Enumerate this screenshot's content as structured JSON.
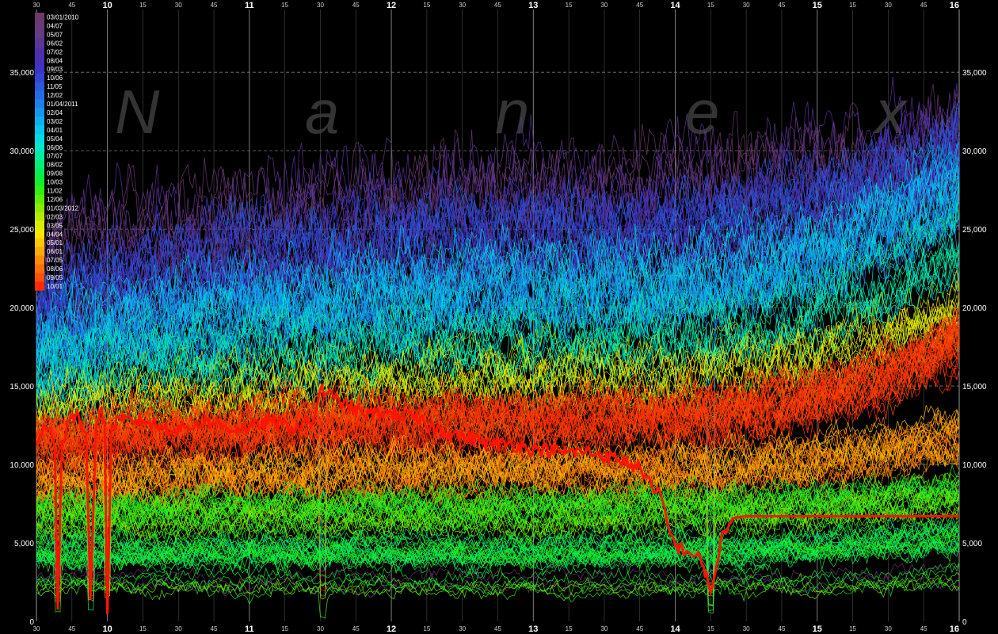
{
  "chart_data": {
    "type": "line",
    "title": "",
    "watermark": [
      "N",
      "a",
      "n",
      "e",
      "x"
    ],
    "xlabel": "",
    "ylabel": "",
    "ylim": [
      0,
      39000
    ],
    "y_ticks": [
      0,
      5000,
      10000,
      15000,
      20000,
      25000,
      30000,
      35000
    ],
    "y_tick_labels": [
      "0",
      "5,000",
      "10,000",
      "15,000",
      "20,000",
      "25,000",
      "30,000",
      "35,000"
    ],
    "x_unit": "hour of trading day",
    "xlim": [
      9.5,
      16
    ],
    "x_hour_ticks": [
      {
        "x": 10,
        "label": "10"
      },
      {
        "x": 11,
        "label": "11"
      },
      {
        "x": 12,
        "label": "12"
      },
      {
        "x": 13,
        "label": "13"
      },
      {
        "x": 14,
        "label": "14"
      },
      {
        "x": 15,
        "label": "15"
      },
      {
        "x": 16,
        "label": "16"
      }
    ],
    "x_minute_labels": [
      "15",
      "30",
      "45"
    ],
    "grid": true,
    "legend_position": "top-left",
    "legend": [
      {
        "label": "03/01/2010",
        "color": "#6b3a6b"
      },
      {
        "label": "04/07",
        "color": "#6a3a76"
      },
      {
        "label": "05/07",
        "color": "#633a86"
      },
      {
        "label": "06/02",
        "color": "#5a3496"
      },
      {
        "label": "07/02",
        "color": "#5030a8"
      },
      {
        "label": "08/04",
        "color": "#4630b8"
      },
      {
        "label": "09/03",
        "color": "#3c34c8"
      },
      {
        "label": "10/06",
        "color": "#3444d4"
      },
      {
        "label": "11/05",
        "color": "#2c58dc"
      },
      {
        "label": "12/02",
        "color": "#246ce4"
      },
      {
        "label": "01/04/2011",
        "color": "#1c82ea"
      },
      {
        "label": "02/04",
        "color": "#1498ee"
      },
      {
        "label": "03/02",
        "color": "#0cb0f0"
      },
      {
        "label": "04/01",
        "color": "#06c8ee"
      },
      {
        "label": "05/04",
        "color": "#00dce6"
      },
      {
        "label": "06/06",
        "color": "#00e8c8"
      },
      {
        "label": "07/07",
        "color": "#00eea0"
      },
      {
        "label": "08/02",
        "color": "#00f078"
      },
      {
        "label": "09/08",
        "color": "#00f050"
      },
      {
        "label": "10/03",
        "color": "#10f030"
      },
      {
        "label": "11/02",
        "color": "#30f010"
      },
      {
        "label": "12/06",
        "color": "#5cee00"
      },
      {
        "label": "01/03/2012",
        "color": "#8aec00"
      },
      {
        "label": "02/03",
        "color": "#b4ea00"
      },
      {
        "label": "03/05",
        "color": "#dcea00"
      },
      {
        "label": "04/04",
        "color": "#ffe600"
      },
      {
        "label": "05/01",
        "color": "#ffc800"
      },
      {
        "label": "06/01",
        "color": "#ffaa00"
      },
      {
        "label": "07/05",
        "color": "#ff8c00"
      },
      {
        "label": "08/06",
        "color": "#ff6e00"
      },
      {
        "label": "09/05",
        "color": "#ff5000"
      },
      {
        "label": "10/01",
        "color": "#ff2a00"
      }
    ],
    "highlight_series": {
      "color": "#ff1400",
      "points": [
        [
          9.5,
          11500
        ],
        [
          9.55,
          12500
        ],
        [
          9.6,
          12300
        ],
        [
          9.63,
          11000
        ],
        [
          9.65,
          800
        ],
        [
          9.68,
          11500
        ],
        [
          9.73,
          12800
        ],
        [
          9.8,
          13000
        ],
        [
          9.85,
          12000
        ],
        [
          9.88,
          1500
        ],
        [
          9.92,
          12500
        ],
        [
          9.95,
          13500
        ],
        [
          9.98,
          12800
        ],
        [
          10.0,
          500
        ],
        [
          10.03,
          12500
        ],
        [
          10.1,
          12800
        ],
        [
          10.25,
          12800
        ],
        [
          10.4,
          12300
        ],
        [
          10.55,
          12300
        ],
        [
          10.7,
          12800
        ],
        [
          10.85,
          12300
        ],
        [
          11.0,
          12300
        ],
        [
          11.15,
          12800
        ],
        [
          11.3,
          12300
        ],
        [
          11.45,
          12800
        ],
        [
          11.5,
          14800
        ],
        [
          11.6,
          14200
        ],
        [
          11.8,
          13200
        ],
        [
          12.0,
          13300
        ],
        [
          12.15,
          13000
        ],
        [
          12.3,
          12300
        ],
        [
          12.5,
          11800
        ],
        [
          12.7,
          11300
        ],
        [
          12.85,
          11300
        ],
        [
          13.0,
          11000
        ],
        [
          13.2,
          10800
        ],
        [
          13.4,
          10800
        ],
        [
          13.6,
          10300
        ],
        [
          13.75,
          9800
        ],
        [
          13.8,
          9200
        ],
        [
          13.85,
          8200
        ],
        [
          13.9,
          8000
        ],
        [
          13.95,
          6000
        ],
        [
          14.0,
          4800
        ],
        [
          14.08,
          4500
        ],
        [
          14.15,
          4200
        ],
        [
          14.2,
          3500
        ],
        [
          14.23,
          2500
        ],
        [
          14.25,
          1800
        ],
        [
          14.28,
          3000
        ],
        [
          14.32,
          5200
        ],
        [
          14.38,
          6200
        ],
        [
          14.42,
          6600
        ],
        [
          14.5,
          6700
        ],
        [
          16.0,
          6700
        ]
      ]
    },
    "background_bands": [
      {
        "colors": [
          "#6b3a6b",
          "#6a3a76",
          "#633a86",
          "#5a3496"
        ],
        "lines": 10,
        "base_start": 21000,
        "base_mid": 26000,
        "base_end": 30000,
        "amplitude": 4500
      },
      {
        "colors": [
          "#5030a8",
          "#4630b8",
          "#3c34c8",
          "#3444d4",
          "#2c58dc",
          "#246ce4"
        ],
        "lines": 26,
        "base_start": 19000,
        "base_mid": 24500,
        "base_end": 30000,
        "amplitude": 3500
      },
      {
        "colors": [
          "#1c82ea",
          "#1498ee",
          "#0cb0f0",
          "#06c8ee",
          "#00dce6"
        ],
        "lines": 32,
        "base_start": 17000,
        "base_mid": 21500,
        "base_end": 28000,
        "amplitude": 3200
      },
      {
        "colors": [
          "#00e8c8",
          "#00eea0"
        ],
        "lines": 14,
        "base_start": 15000,
        "base_mid": 18000,
        "base_end": 24000,
        "amplitude": 2600
      },
      {
        "colors": [
          "#ffe600",
          "#dcea00",
          "#b4ea00"
        ],
        "lines": 14,
        "base_start": 13000,
        "base_mid": 15500,
        "base_end": 20000,
        "amplitude": 2400
      },
      {
        "colors": [
          "#ff2a00",
          "#ff5000",
          "#ff3800"
        ],
        "lines": 34,
        "base_start": 11000,
        "base_mid": 12500,
        "base_end": 17500,
        "amplitude": 2200
      },
      {
        "colors": [
          "#ff6e00",
          "#ff8c00",
          "#ffaa00",
          "#ffc800"
        ],
        "lines": 26,
        "base_start": 8500,
        "base_mid": 9500,
        "base_end": 11500,
        "amplitude": 1800
      },
      {
        "colors": [
          "#8aec00",
          "#5cee00",
          "#30f010",
          "#10f030"
        ],
        "lines": 28,
        "base_start": 6500,
        "base_mid": 7000,
        "base_end": 8000,
        "amplitude": 1500
      },
      {
        "colors": [
          "#00f050",
          "#00f078",
          "#30f010",
          "#10f030"
        ],
        "lines": 24,
        "base_start": 4500,
        "base_mid": 4500,
        "base_end": 5500,
        "amplitude": 1200
      },
      {
        "colors": [
          "#10f030",
          "#5cee00",
          "#6b3a6b"
        ],
        "lines": 8,
        "base_start": 2500,
        "base_mid": 2500,
        "base_end": 3000,
        "amplitude": 900
      }
    ]
  }
}
